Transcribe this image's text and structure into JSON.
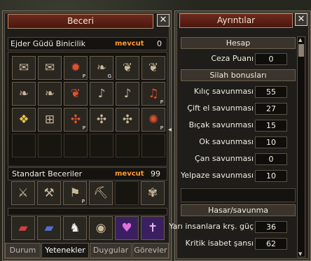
{
  "left": {
    "title": "Beceri",
    "close": "✕",
    "skill_tab": "Ejder Güdü Binicilik",
    "mevcut_label": "mevcut",
    "mevcut_value": "0",
    "standard_label": "Standart Beceriler",
    "standard_mevcut": "mevcut",
    "standard_value": "99",
    "tabs": [
      "Durum",
      "Yetenekler",
      "Duygular",
      "Görevler"
    ]
  },
  "right": {
    "title": "Ayrıntılar",
    "close": "✕",
    "sections": {
      "hesap": "Hesap",
      "silah": "Silah bonusları",
      "hasar": "Hasar/savunma"
    },
    "ceza": {
      "label": "Ceza Puanı",
      "value": "0"
    },
    "weapons": [
      {
        "label": "Kılıç savunması",
        "value": "55"
      },
      {
        "label": "Çift el savunması",
        "value": "27"
      },
      {
        "label": "Bıçak savunması",
        "value": "15"
      },
      {
        "label": "Ok savunması",
        "value": "10"
      },
      {
        "label": "Çan savunması",
        "value": "0"
      },
      {
        "label": "Yelpaze savunması",
        "value": "10"
      }
    ],
    "damage": [
      {
        "label": "Yarı insanlara krş. güç",
        "value": "36"
      },
      {
        "label": "Kritik isabet şansı",
        "value": "62"
      }
    ]
  },
  "skill_icons": [
    "scroll-icon",
    "scroll-icon",
    "flame-icon",
    "dragon-icon",
    "dragon-icon",
    "dragon-icon",
    "dragon-icon",
    "dragon-icon",
    "dragon-icon",
    "bell-icon",
    "bell-icon",
    "bell-icon",
    "shield-icon",
    "grid-icon",
    "shuriken-icon",
    "shuriken-icon",
    "shuriken-icon",
    "spiral-icon"
  ],
  "std_icons": [
    "sword-icon",
    "broom-icon",
    "flag-icon",
    "pickaxe-icon",
    "empty",
    "emblem-icon"
  ],
  "bottom_icons": [
    "book-red-icon",
    "book-blue-icon",
    "horse-icon",
    "seal-icon",
    "heart-icon",
    "cross-icon"
  ]
}
